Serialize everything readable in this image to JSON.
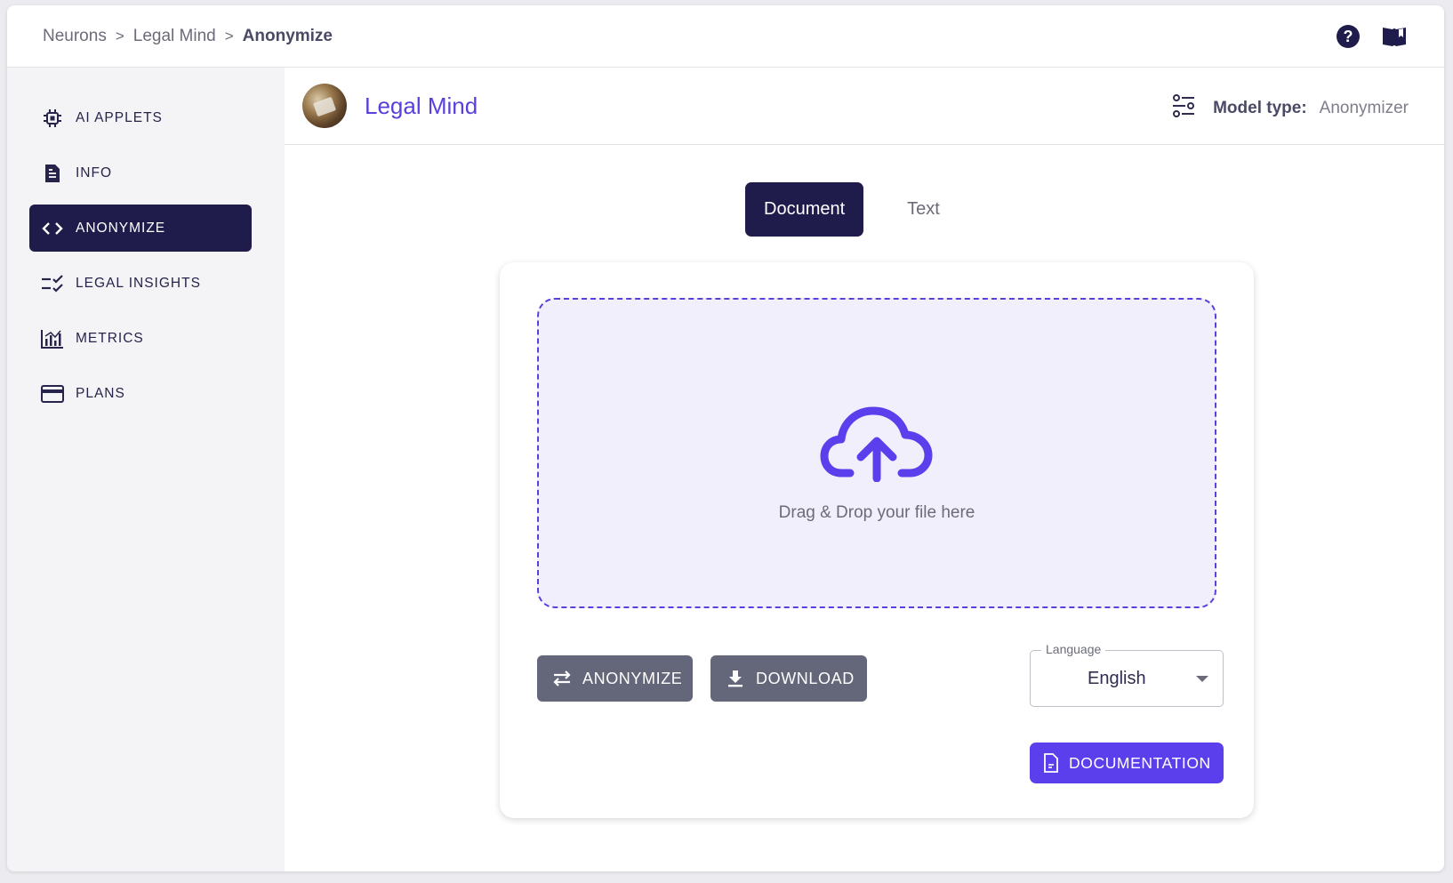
{
  "breadcrumb": {
    "items": [
      "Neurons",
      "Legal Mind",
      "Anonymize"
    ],
    "separator": ">"
  },
  "topbar": {
    "icons": [
      "help-circle-icon",
      "book-icon"
    ]
  },
  "sidebar": {
    "items": [
      {
        "label": "AI APPLETS",
        "icon": "chip-icon",
        "active": false
      },
      {
        "label": "INFO",
        "icon": "document-icon",
        "active": false
      },
      {
        "label": "ANONYMIZE",
        "icon": "code-icon",
        "active": true
      },
      {
        "label": "LEGAL INSIGHTS",
        "icon": "checklist-icon",
        "active": false
      },
      {
        "label": "METRICS",
        "icon": "bar-chart-icon",
        "active": false
      },
      {
        "label": "PLANS",
        "icon": "credit-card-icon",
        "active": false
      }
    ]
  },
  "applet": {
    "title": "Legal Mind",
    "model_type_label": "Model type:",
    "model_type_value": "Anonymizer"
  },
  "tabs": [
    {
      "label": "Document",
      "active": true
    },
    {
      "label": "Text",
      "active": false
    }
  ],
  "dropzone": {
    "hint": "Drag & Drop your file here"
  },
  "actions": {
    "anonymize_label": "ANONYMIZE",
    "download_label": "DOWNLOAD",
    "documentation_label": "DOCUMENTATION"
  },
  "language": {
    "legend": "Language",
    "value": "English"
  },
  "colors": {
    "accent": "#5b3fec",
    "nav_active": "#1f1b4b",
    "button_gray": "#646679",
    "dropzone_bg": "#f1effb"
  }
}
